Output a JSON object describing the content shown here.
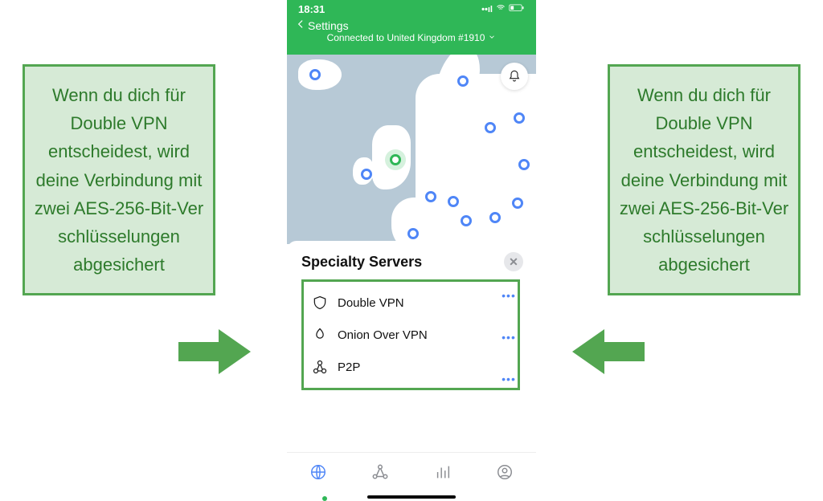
{
  "callout_left": "Wenn du dich für Double VPN entscheidest, wird deine Verbindung mit zwei AES-256-Bit-Ver schlüsselungen abgesichert",
  "callout_right": "Wenn du dich für Double VPN entscheidest, wird deine Verbindung mit zwei AES-256-Bit-Ver schlüsselungen abgesichert",
  "status": {
    "time": "18:31",
    "signal": "ıll",
    "wifi": "Wi-Fi",
    "battery": "low"
  },
  "nav": {
    "back_label": "Settings",
    "connection_status": "Connected to United Kingdom #1910"
  },
  "sheet": {
    "title": "Specialty Servers",
    "servers": [
      {
        "label": "Double VPN",
        "icon": "double-vpn-icon"
      },
      {
        "label": "Onion Over VPN",
        "icon": "onion-icon"
      },
      {
        "label": "P2P",
        "icon": "p2p-icon"
      }
    ]
  },
  "colors": {
    "accent_green": "#2fb757",
    "callout_green": "#53a651",
    "blue": "#4f86f7"
  }
}
